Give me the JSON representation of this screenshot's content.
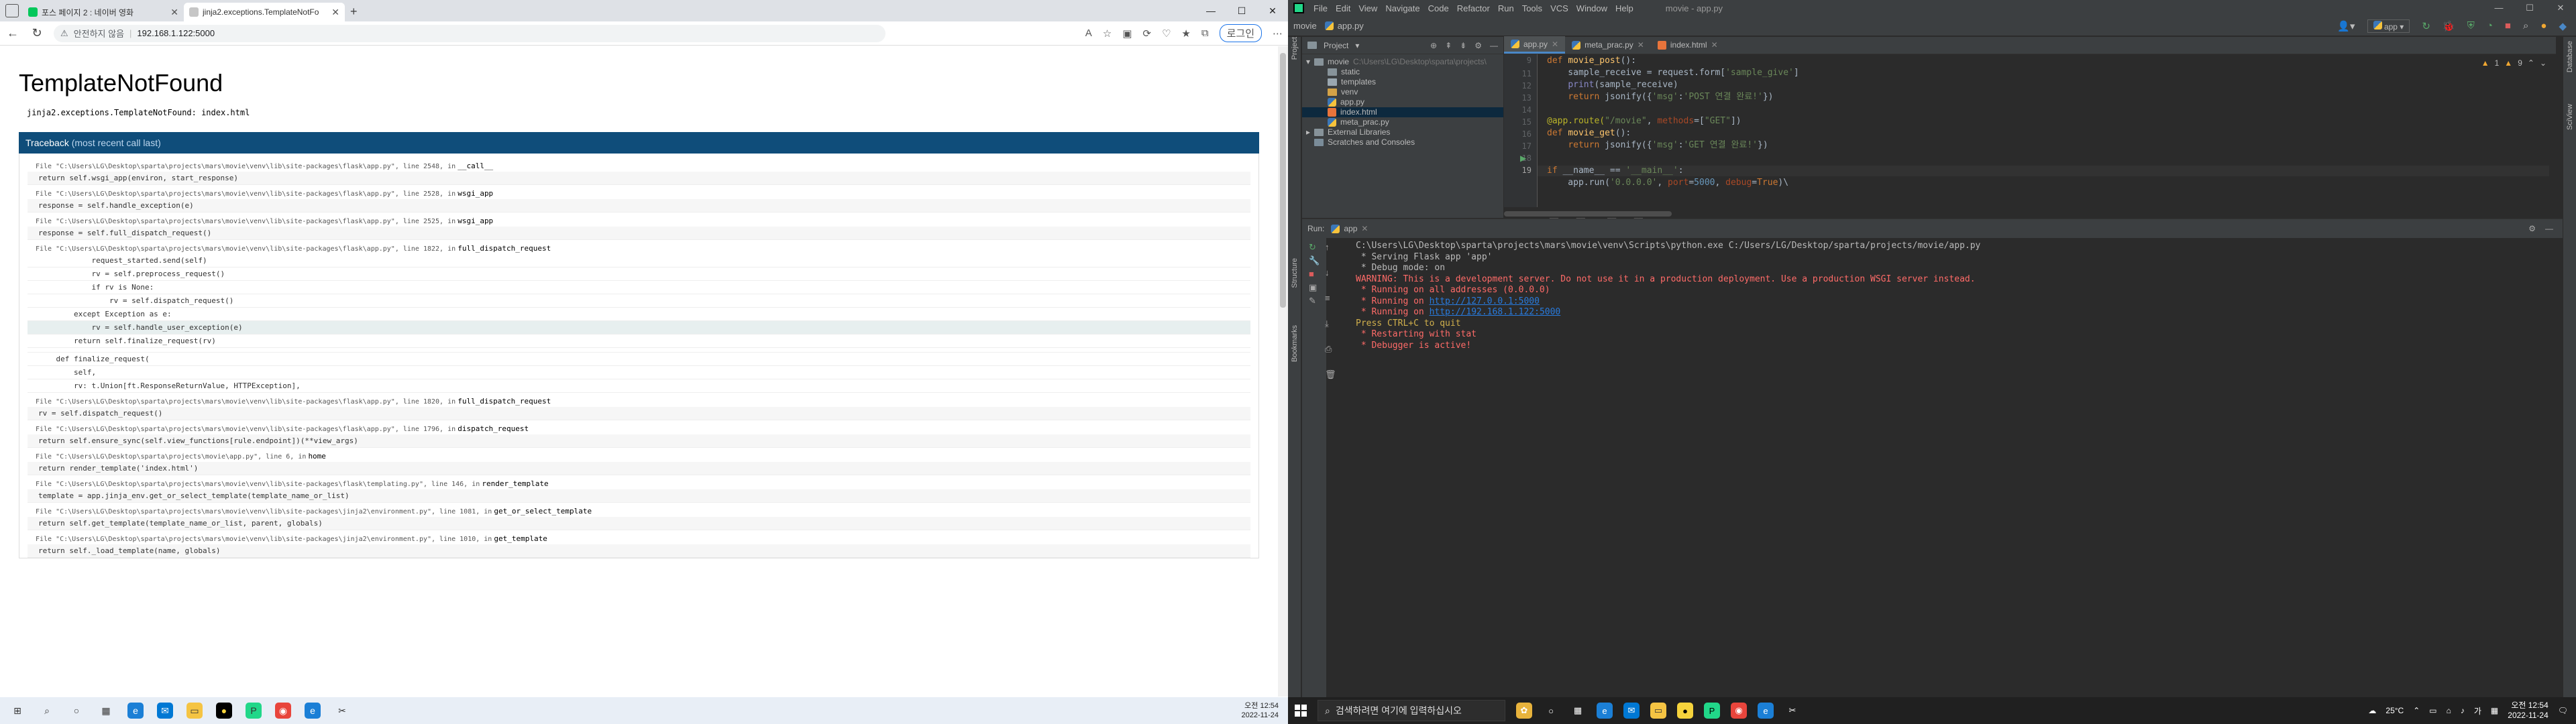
{
  "browser": {
    "tabs": [
      {
        "title": "포스 페이지 2 : 네이버 영화",
        "active": false
      },
      {
        "title": "jinja2.exceptions.TemplateNotFo",
        "active": true
      }
    ],
    "security_label": "안전하지 않음",
    "url": "192.168.1.122:5000",
    "login_label": "로그인",
    "page": {
      "title": "TemplateNotFound",
      "message": "jinja2.exceptions.TemplateNotFound: index.html",
      "traceback_label": "Traceback",
      "traceback_sub": "(most recent call last)",
      "frames": [
        {
          "file": "File \"C:\\Users\\LG\\Desktop\\sparta\\projects\\mars\\movie\\venv\\lib\\site-packages\\flask\\app.py\", line 2548, in",
          "fn": "__call__",
          "lines": [
            "return self.wsgi_app(environ, start_response)"
          ]
        },
        {
          "file": "File \"C:\\Users\\LG\\Desktop\\sparta\\projects\\mars\\movie\\venv\\lib\\site-packages\\flask\\app.py\", line 2528, in",
          "fn": "wsgi_app",
          "lines": [
            "response = self.handle_exception(e)"
          ]
        },
        {
          "file": "File \"C:\\Users\\LG\\Desktop\\sparta\\projects\\mars\\movie\\venv\\lib\\site-packages\\flask\\app.py\", line 2525, in",
          "fn": "wsgi_app",
          "lines": [
            "response = self.full_dispatch_request()"
          ]
        },
        {
          "file": "File \"C:\\Users\\LG\\Desktop\\sparta\\projects\\mars\\movie\\venv\\lib\\site-packages\\flask\\app.py\", line 1822, in",
          "fn": "full_dispatch_request",
          "lines": [
            "            request_started.send(self)",
            "            rv = self.preprocess_request()",
            "            if rv is None:",
            "                rv = self.dispatch_request()",
            "        except Exception as e:",
            "            rv = self.handle_user_exception(e)",
            "        return self.finalize_request(rv)",
            "",
            "    def finalize_request(",
            "        self,",
            "        rv: t.Union[ft.ResponseReturnValue, HTTPException],"
          ]
        },
        {
          "file": "File \"C:\\Users\\LG\\Desktop\\sparta\\projects\\mars\\movie\\venv\\lib\\site-packages\\flask\\app.py\", line 1820, in",
          "fn": "full_dispatch_request",
          "lines": [
            "rv = self.dispatch_request()"
          ]
        },
        {
          "file": "File \"C:\\Users\\LG\\Desktop\\sparta\\projects\\mars\\movie\\venv\\lib\\site-packages\\flask\\app.py\", line 1796, in",
          "fn": "dispatch_request",
          "lines": [
            "return self.ensure_sync(self.view_functions[rule.endpoint])(**view_args)"
          ]
        },
        {
          "file": "File \"C:\\Users\\LG\\Desktop\\sparta\\projects\\movie\\app.py\", line 6, in",
          "fn": "home",
          "lines": [
            "return render_template('index.html')"
          ]
        },
        {
          "file": "File \"C:\\Users\\LG\\Desktop\\sparta\\projects\\mars\\movie\\venv\\lib\\site-packages\\flask\\templating.py\", line 146, in",
          "fn": "render_template",
          "lines": [
            "template = app.jinja_env.get_or_select_template(template_name_or_list)"
          ]
        },
        {
          "file": "File \"C:\\Users\\LG\\Desktop\\sparta\\projects\\mars\\movie\\venv\\lib\\site-packages\\jinja2\\environment.py\", line 1081, in",
          "fn": "get_or_select_template",
          "lines": [
            "return self.get_template(template_name_or_list, parent, globals)"
          ]
        },
        {
          "file": "File \"C:\\Users\\LG\\Desktop\\sparta\\projects\\mars\\movie\\venv\\lib\\site-packages\\jinja2\\environment.py\", line 1010, in",
          "fn": "get_template",
          "lines": [
            "return self._load_template(name, globals)"
          ]
        }
      ]
    },
    "clock": {
      "time": "오전 12:54",
      "date": "2022-11-24"
    }
  },
  "pycharm": {
    "menu": [
      "File",
      "Edit",
      "View",
      "Navigate",
      "Code",
      "Refactor",
      "Run",
      "Tools",
      "VCS",
      "Window",
      "Help"
    ],
    "window_title": "movie - app.py",
    "nav": {
      "project": "movie",
      "file": "app.py",
      "run_config": "app"
    },
    "project_panel": {
      "label": "Project",
      "root": "movie",
      "root_path": "C:\\Users\\LG\\Desktop\\sparta\\projects\\",
      "items": [
        "static",
        "templates",
        "venv",
        "app.py",
        "index.html",
        "meta_prac.py"
      ],
      "external": "External Libraries",
      "scratches": "Scratches and Consoles"
    },
    "editor_tabs": [
      "app.py",
      "meta_prac.py",
      "index.html"
    ],
    "line_numbers": [
      "9",
      "11",
      "12",
      "13",
      "14",
      "15",
      "16",
      "17",
      "18",
      "19"
    ],
    "inspections": {
      "warnings": "1",
      "weak": "9"
    },
    "breadcrumb": "if __name__ == '__main__'",
    "run": {
      "label": "Run:",
      "tab": "app",
      "console": [
        "C:\\Users\\LG\\Desktop\\sparta\\projects\\mars\\movie\\venv\\Scripts\\python.exe C:/Users/LG/Desktop/sparta/projects/movie/app.py",
        " * Serving Flask app 'app'",
        " * Debug mode: on",
        "WARNING: This is a development server. Do not use it in a production deployment. Use a production WSGI server instead.",
        " * Running on all addresses (0.0.0.0)",
        " * Running on ",
        "http://127.0.0.1:5000",
        " * Running on ",
        "http://192.168.1.122:5000",
        "Press CTRL+C to quit",
        " * Restarting with stat",
        " * Debugger is active!"
      ]
    },
    "side_labels": [
      "Project",
      "Structure",
      "Bookmarks",
      "Database",
      "SciView"
    ],
    "taskbar": {
      "search_placeholder": "검색하려면 여기에 입력하십시오",
      "weather": "25°C",
      "time": "오전 12:54",
      "date": "2022-11-24"
    }
  }
}
